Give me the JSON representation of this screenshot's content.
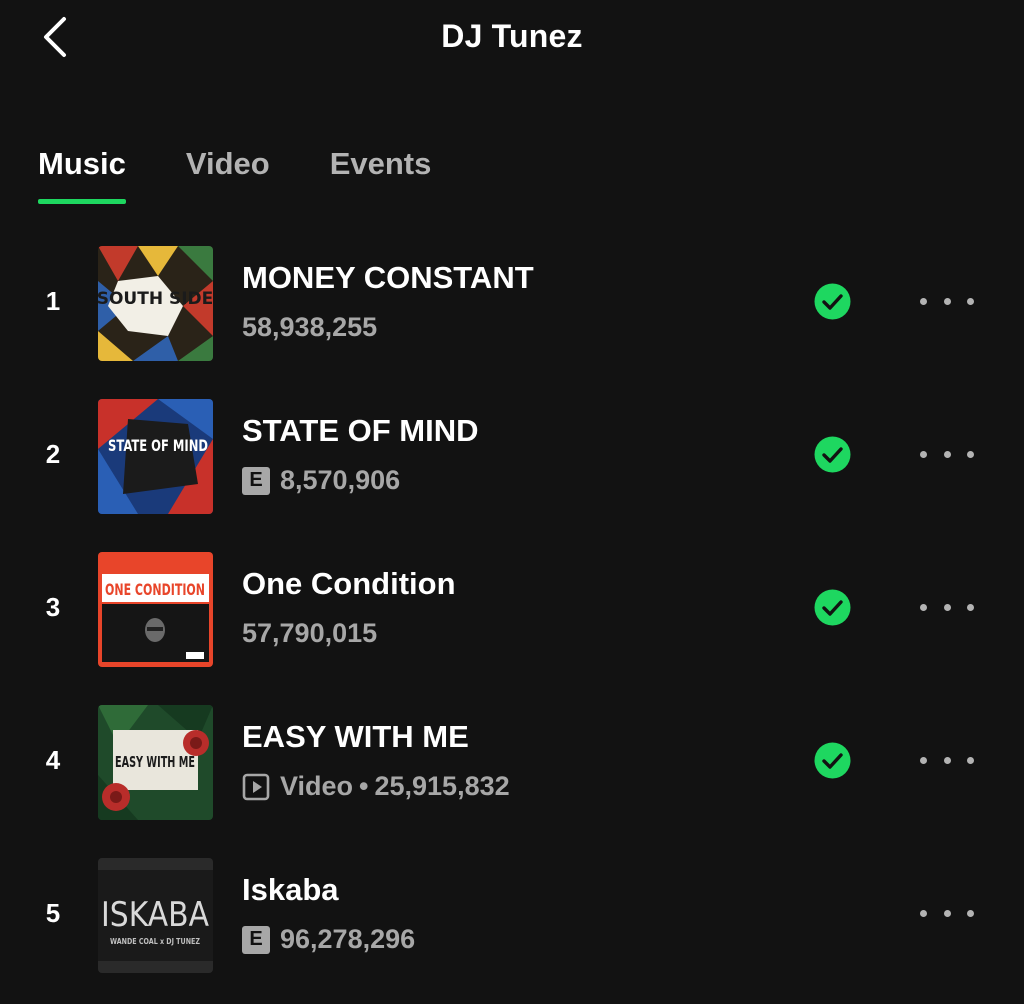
{
  "header": {
    "title": "DJ Tunez",
    "back_icon": "chevron-left-icon"
  },
  "tabs": [
    {
      "label": "Music",
      "active": true
    },
    {
      "label": "Video",
      "active": false
    },
    {
      "label": "Events",
      "active": false
    }
  ],
  "tracks": [
    {
      "rank": "1",
      "title": "MONEY CONSTANT",
      "plays": "58,938,255",
      "explicit": false,
      "video": false,
      "liked": true,
      "cover_text": "SOUTH SIDE"
    },
    {
      "rank": "2",
      "title": "STATE OF MIND",
      "plays": "8,570,906",
      "explicit": true,
      "explicit_label": "E",
      "video": false,
      "liked": true,
      "cover_text": "STATE OF MIND"
    },
    {
      "rank": "3",
      "title": "One Condition",
      "plays": "57,790,015",
      "explicit": false,
      "video": false,
      "liked": true,
      "cover_text": "ONE CONDITION"
    },
    {
      "rank": "4",
      "title": "EASY WITH ME",
      "plays": "25,915,832",
      "explicit": false,
      "video": true,
      "video_label": "Video",
      "separator": "•",
      "liked": true,
      "cover_text": "EASY WITH ME"
    },
    {
      "rank": "5",
      "title": "Iskaba",
      "plays": "96,278,296",
      "explicit": true,
      "explicit_label": "E",
      "video": false,
      "liked": false,
      "cover_text": "ISKABA",
      "cover_subtext": "WANDE COAL x DJ TUNEZ"
    }
  ],
  "colors": {
    "background": "#121212",
    "accent": "#1ed760",
    "text_primary": "#ffffff",
    "text_secondary": "#a7a7a7"
  },
  "icons": {
    "liked": "check-circle-icon",
    "more": "more-options-icon",
    "explicit": "explicit-badge",
    "video": "video-play-icon"
  }
}
